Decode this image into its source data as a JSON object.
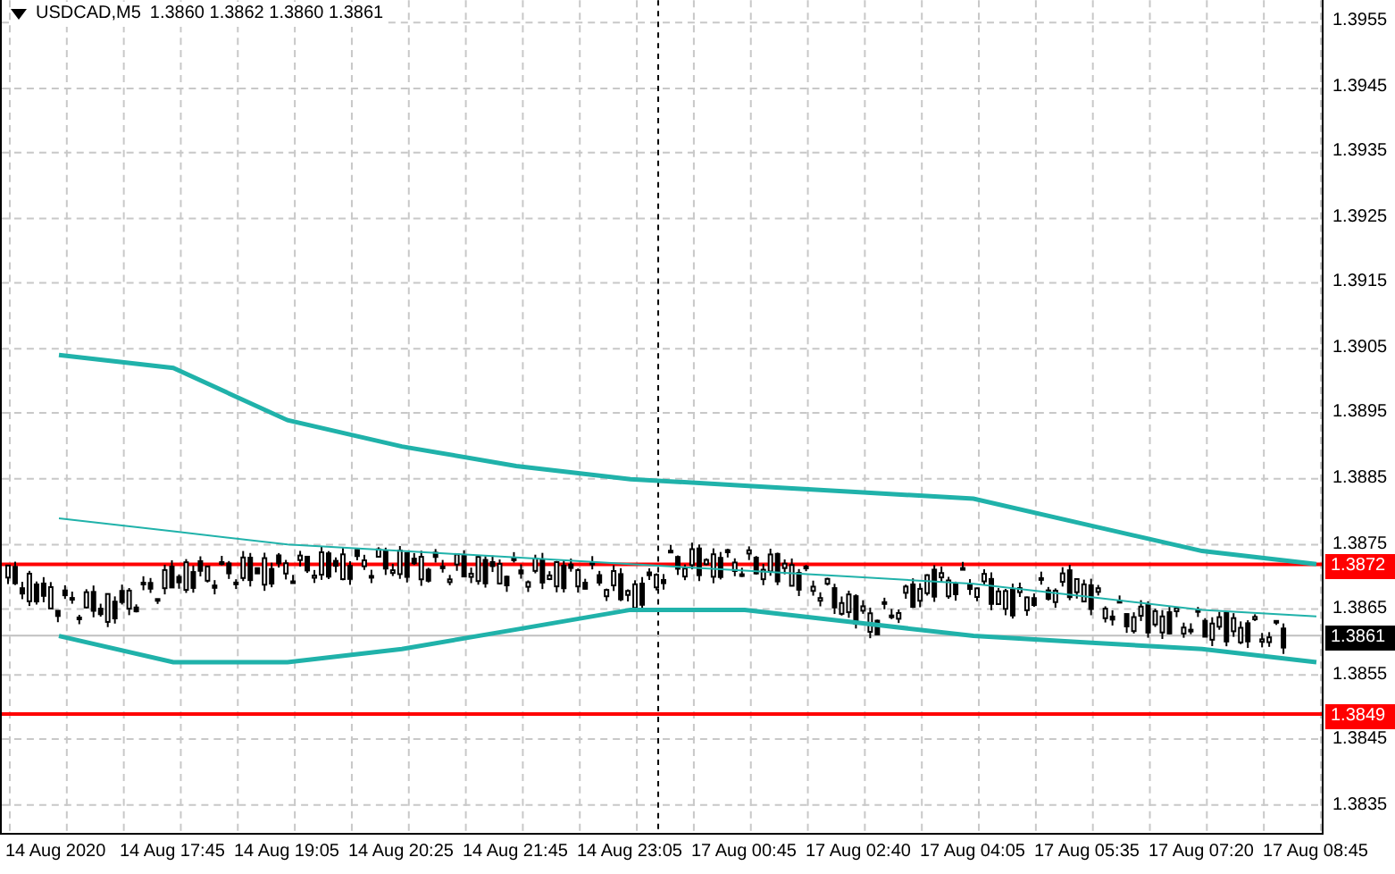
{
  "chart": {
    "symbol": "USDCAD,M5",
    "quote": "1.3860 1.3862 1.3860 1.3861",
    "chart_data": {
      "type": "line",
      "grid": true,
      "categories": [
        "14 Aug 2020",
        "14 Aug 17:45",
        "14 Aug 19:05",
        "14 Aug 20:25",
        "14 Aug 21:45",
        "14 Aug 23:05",
        "17 Aug 00:45",
        "17 Aug 02:40",
        "17 Aug 04:05",
        "17 Aug 05:35",
        "17 Aug 07:20",
        "17 Aug 08:45"
      ],
      "ylim": [
        1.38306,
        1.39583
      ],
      "yticks": [
        1.3955,
        1.3945,
        1.3935,
        1.3925,
        1.3915,
        1.3905,
        1.3895,
        1.3885,
        1.3875,
        1.3865,
        1.3855,
        1.3845,
        1.3835
      ],
      "series": [
        {
          "color": "#20b2aa",
          "values": [
            1.3904,
            1.3902,
            1.3894,
            1.389,
            1.3887,
            1.3885,
            1.3884,
            1.3883,
            1.3882,
            1.3878,
            1.3874,
            1.3872
          ]
        },
        {
          "color": "#20b2aa",
          "values": [
            1.3879,
            1.3877,
            1.3875,
            1.3874,
            1.3873,
            1.3872,
            1.3871,
            1.387,
            1.3869,
            1.3867,
            1.3865,
            1.3864
          ]
        },
        {
          "color": "#20b2aa",
          "values": [
            1.3861,
            1.3857,
            1.3857,
            1.3859,
            1.3862,
            1.3865,
            1.3865,
            1.3863,
            1.3861,
            1.386,
            1.3859,
            1.3857
          ]
        }
      ]
    }
  },
  "price_tags": [
    {
      "label": "1.3872",
      "kind": "level",
      "color": "#ff0000"
    },
    {
      "label": "1.3861",
      "kind": "bid",
      "color": "#000000"
    },
    {
      "label": "1.3849",
      "kind": "level",
      "color": "#ff0000"
    }
  ]
}
